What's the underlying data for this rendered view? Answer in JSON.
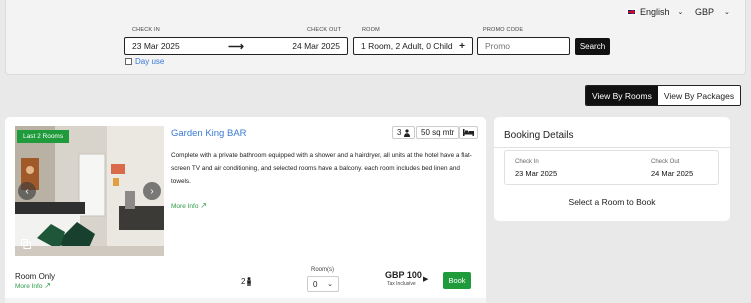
{
  "header": {
    "language": "English",
    "currency": "GBP"
  },
  "search": {
    "check_in_label": "CHECK IN",
    "check_out_label": "CHECK OUT",
    "room_label": "ROOM",
    "promo_label": "PROMO CODE",
    "check_in_value": "23 Mar 2025",
    "check_out_value": "24 Mar 2025",
    "room_value": "1 Room, 2 Adult, 0 Child",
    "promo_placeholder": "Promo",
    "search_button": "Search",
    "day_use_label": "Day use"
  },
  "view_toggle": {
    "by_rooms": "View By Rooms",
    "by_packages": "View By Packages",
    "active": "by_rooms"
  },
  "room": {
    "badge": "Last 2 Rooms",
    "title": "Garden King BAR",
    "occupancy": "3",
    "size": "50 sq mtr",
    "description": "Complete with a private bathroom equipped with a shower and a hairdryer, all units at the hotel have a flat-screen TV and air conditioning, and selected rooms have a balcony. each room includes bed linen and towels.",
    "more_info": "More Info",
    "rate_name": "Room Only",
    "rate_more_info": "More Info",
    "guests": "2",
    "rooms_label": "Room(s)",
    "rooms_value": "0",
    "price": "GBP 100",
    "tax_note": "Tax Inclusive",
    "book_button": "Book"
  },
  "booking": {
    "title": "Booking Details",
    "check_in_label": "Check In",
    "check_in_value": "23 Mar 2025",
    "check_out_label": "Check Out",
    "check_out_value": "24 Mar 2025",
    "select_prompt": "Select a Room to Book"
  },
  "colors": {
    "accent_green": "#1f9b3c",
    "link_blue": "#3a7bd5",
    "dark": "#111111"
  }
}
